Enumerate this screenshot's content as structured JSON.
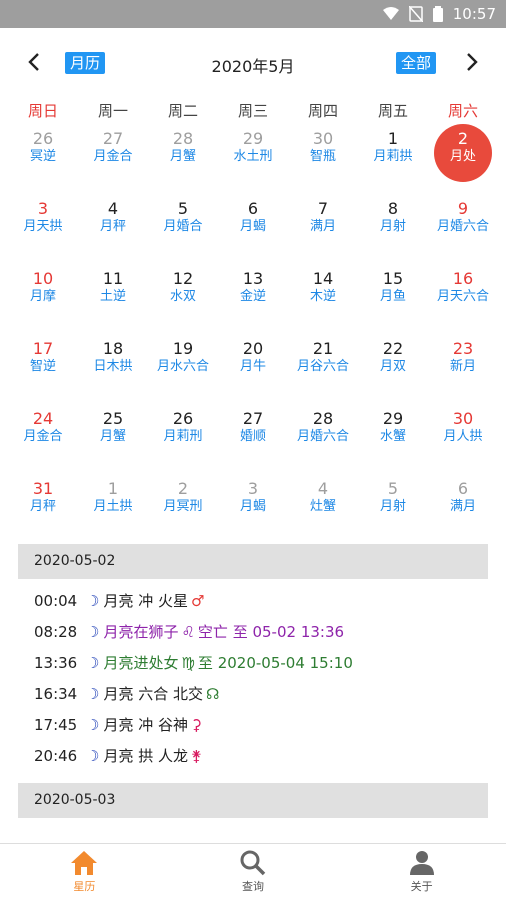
{
  "status": {
    "time": "10:57"
  },
  "header": {
    "left_pill": "月历",
    "title": "2020年5月",
    "right_pill": "全部"
  },
  "weekdays": [
    "周日",
    "周一",
    "周二",
    "周三",
    "周四",
    "周五",
    "周六"
  ],
  "weeks": [
    [
      {
        "day": "26",
        "text": "冥逆"
      },
      {
        "day": "27",
        "text": "月金合"
      },
      {
        "day": "28",
        "text": "月蟹"
      },
      {
        "day": "29",
        "text": "水土刑"
      },
      {
        "day": "30",
        "text": "智瓶"
      },
      {
        "day": "1",
        "text": "月莉拱"
      },
      {
        "day": "2",
        "text": "月处"
      }
    ],
    [
      {
        "day": "3",
        "text": "月天拱"
      },
      {
        "day": "4",
        "text": "月秤"
      },
      {
        "day": "5",
        "text": "月婚合"
      },
      {
        "day": "6",
        "text": "月蝎"
      },
      {
        "day": "7",
        "text": "满月"
      },
      {
        "day": "8",
        "text": "月射"
      },
      {
        "day": "9",
        "text": "月婚六合"
      }
    ],
    [
      {
        "day": "10",
        "text": "月摩"
      },
      {
        "day": "11",
        "text": "土逆"
      },
      {
        "day": "12",
        "text": "水双"
      },
      {
        "day": "13",
        "text": "金逆"
      },
      {
        "day": "14",
        "text": "木逆"
      },
      {
        "day": "15",
        "text": "月鱼"
      },
      {
        "day": "16",
        "text": "月天六合"
      }
    ],
    [
      {
        "day": "17",
        "text": "智逆"
      },
      {
        "day": "18",
        "text": "日木拱"
      },
      {
        "day": "19",
        "text": "月水六合"
      },
      {
        "day": "20",
        "text": "月牛"
      },
      {
        "day": "21",
        "text": "月谷六合"
      },
      {
        "day": "22",
        "text": "月双"
      },
      {
        "day": "23",
        "text": "新月"
      }
    ],
    [
      {
        "day": "24",
        "text": "月金合"
      },
      {
        "day": "25",
        "text": "月蟹"
      },
      {
        "day": "26",
        "text": "月莉刑"
      },
      {
        "day": "27",
        "text": "婚顺"
      },
      {
        "day": "28",
        "text": "月婚六合"
      },
      {
        "day": "29",
        "text": "水蟹"
      },
      {
        "day": "30",
        "text": "月人拱"
      }
    ],
    [
      {
        "day": "31",
        "text": "月秤"
      },
      {
        "day": "1",
        "text": "月土拱"
      },
      {
        "day": "2",
        "text": "月冥刑"
      },
      {
        "day": "3",
        "text": "月蝎"
      },
      {
        "day": "4",
        "text": "灶蟹"
      },
      {
        "day": "5",
        "text": "月射"
      },
      {
        "day": "6",
        "text": "满月"
      }
    ]
  ],
  "section1": {
    "date": "2020-05-02"
  },
  "events": [
    {
      "time": "00:04",
      "moon": "☽",
      "text": "月亮 冲 火星",
      "sym": "♂",
      "symcolor": "#e53935",
      "cls": ""
    },
    {
      "time": "08:28",
      "moon": "☽",
      "text": "月亮在狮子",
      "sym": "♌",
      "symcolor": "#8e24aa",
      "extra": "空亡 至 05-02 13:36",
      "cls": "purple"
    },
    {
      "time": "13:36",
      "moon": "☽",
      "text": "月亮进处女",
      "sym": "♍",
      "symcolor": "#2e7d32",
      "extra": "至 2020-05-04 15:10",
      "cls": "green"
    },
    {
      "time": "16:34",
      "moon": "☽",
      "text": "月亮 六合 北交",
      "sym": "☊",
      "symcolor": "#2e7d32",
      "cls": ""
    },
    {
      "time": "17:45",
      "moon": "☽",
      "text": "月亮 冲 谷神",
      "sym": "⚳",
      "symcolor": "#d81b60",
      "cls": ""
    },
    {
      "time": "20:46",
      "moon": "☽",
      "text": "月亮 拱 人龙",
      "sym": "⚵",
      "symcolor": "#d81b60",
      "cls": ""
    }
  ],
  "section2": {
    "date": "2020-05-03"
  },
  "tabs": [
    {
      "label": "星历",
      "icon": "home-icon"
    },
    {
      "label": "查询",
      "icon": "search-icon"
    },
    {
      "label": "关于",
      "icon": "person-icon"
    }
  ]
}
